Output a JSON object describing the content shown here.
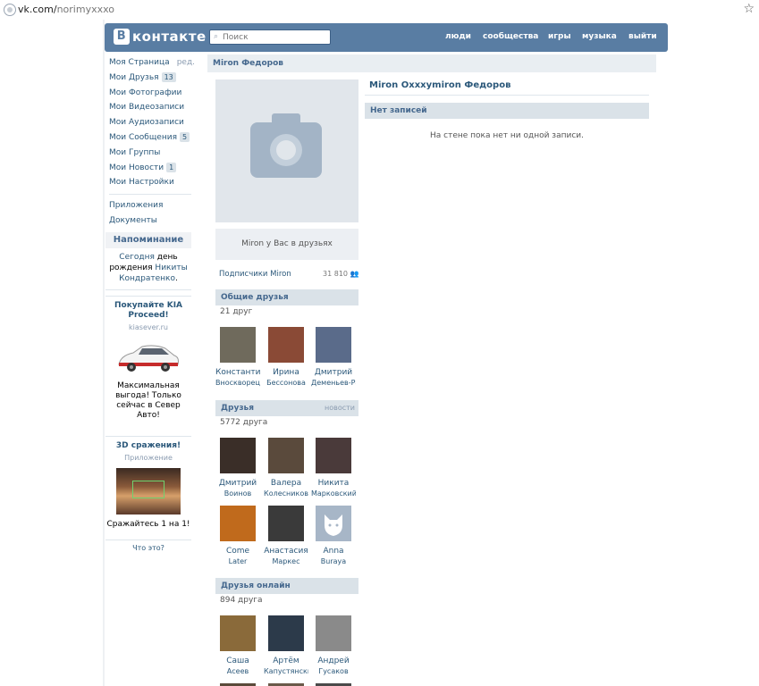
{
  "browser": {
    "url_host": "vk.com/",
    "url_path": "norimyxxxo"
  },
  "header": {
    "logo_letter": "В",
    "logo_text": "контакте",
    "search_placeholder": "Поиск",
    "nav": [
      "люди",
      "сообщества",
      "игры",
      "музыка",
      "выйти"
    ]
  },
  "sidebar": {
    "items": [
      {
        "label": "Моя Страница",
        "extra": "ред."
      },
      {
        "label": "Мои Друзья",
        "badge": "13"
      },
      {
        "label": "Мои Фотографии"
      },
      {
        "label": "Мои Видеозаписи"
      },
      {
        "label": "Мои Аудиозаписи"
      },
      {
        "label": "Мои Сообщения",
        "badge": "5"
      },
      {
        "label": "Мои Группы"
      },
      {
        "label": "Мои Новости",
        "badge": "1"
      },
      {
        "label": "Мои Настройки"
      }
    ],
    "extra_items": [
      {
        "label": "Приложения"
      },
      {
        "label": "Документы"
      }
    ],
    "reminder": {
      "title": "Напоминание",
      "today": "Сегодня",
      "birthday": "день рождения",
      "name": "Никиты Кондратенко",
      "end": "."
    },
    "ad1": {
      "title": "Покупайте KIA Proceed!",
      "domain": "kiasever.ru",
      "text": "Максимальная выгода! Только сейчас в Север Авто!"
    },
    "ad2": {
      "title": "3D сражения!",
      "sub": "Приложение",
      "text": "Сражайтесь 1 на 1!"
    },
    "what": "Что это?"
  },
  "profile": {
    "page_title": "Miron Федоров",
    "full_name": "Miron Oxxxymiron Федоров",
    "friend_status": "Miron у Вас в друзьях",
    "subscribers_label": "Подписчики Miron",
    "subscribers_count": "31 810"
  },
  "common_friends": {
    "title": "Общие друзья",
    "count": "21 друг",
    "people": [
      {
        "first": "Константин",
        "last": "Вноскворецкий",
        "color": "#6f6a5c"
      },
      {
        "first": "Ирина",
        "last": "Бессонова",
        "color": "#8a4a36"
      },
      {
        "first": "Дмитрий",
        "last": "Деменьев-Радин",
        "color": "#5a6b8a"
      }
    ]
  },
  "friends": {
    "title": "Друзья",
    "link": "новости",
    "count": "5772 друга",
    "people": [
      {
        "first": "Дмитрий",
        "last": "Воинов",
        "color": "#3a2e28"
      },
      {
        "first": "Валера",
        "last": "Колесников",
        "color": "#5a4a3c"
      },
      {
        "first": "Никита",
        "last": "Марковский",
        "color": "#4a3a3a"
      },
      {
        "first": "Come",
        "last": "Later",
        "color": "#c06a1c"
      },
      {
        "first": "Анастасия",
        "last": "Маркес",
        "color": "#3a3a3a"
      },
      {
        "first": "Anna",
        "last": "Buraya",
        "color": "#a7b6c7"
      }
    ]
  },
  "friends_online": {
    "title": "Друзья онлайн",
    "count": "894 друга",
    "people": [
      {
        "first": "Саша",
        "last": "Асеев",
        "color": "#8a6a3a"
      },
      {
        "first": "Артём",
        "last": "Капустянский",
        "color": "#2c3a4a"
      },
      {
        "first": "Андрей",
        "last": "Гусаков",
        "color": "#8a8a8a"
      }
    ]
  },
  "wall": {
    "header": "Нет записей",
    "empty": "На стене пока нет ни одной записи."
  }
}
